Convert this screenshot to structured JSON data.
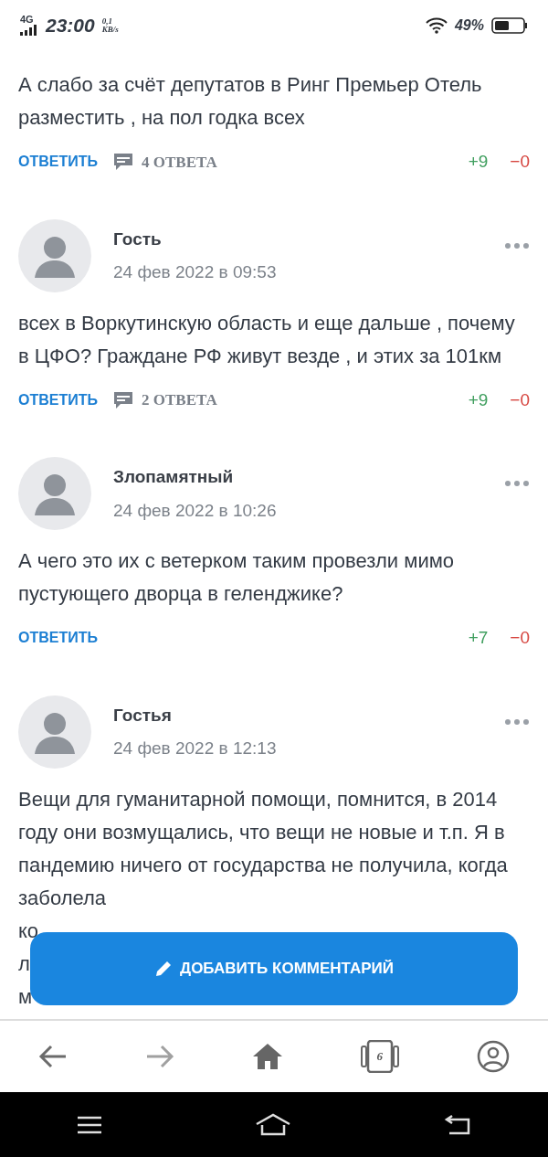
{
  "status_bar": {
    "network": "4G",
    "time": "23:00",
    "speed": "0,1",
    "speed_unit": "KB/s",
    "battery": "49%"
  },
  "comments": [
    {
      "text": "А слабо за счёт депутатов в Ринг Премьер Отель разместить , на пол годка всех",
      "reply": "ОТВЕТИТЬ",
      "replies": "4 ОТВЕТА",
      "plus": "+9",
      "minus": "−0"
    },
    {
      "author": "Гость",
      "date": "24 фев 2022 в 09:53",
      "text": "всех в Воркутинскую область и еще дальше , почему в ЦФО? Граждане РФ живут везде , и этих за 101км",
      "reply": "ОТВЕТИТЬ",
      "replies": "2 ОТВЕТА",
      "plus": "+9",
      "minus": "−0"
    },
    {
      "author": "Злопамятный",
      "date": "24 фев 2022 в 10:26",
      "text": "А чего это их с ветерком таким провезли мимо пустующего дворца в геленджике?",
      "reply": "ОТВЕТИТЬ",
      "plus": "+7",
      "minus": "−0"
    },
    {
      "author": "Гостья",
      "date": "24 фев 2022 в 12:13",
      "text": "Вещи для гуманитарной помощи, помнится, в 2014 году они возмущались, что вещи не новые и т.п. Я в пандемию ничего от государства не получила, когда заболела",
      "cut_lines": [
        "ко",
        "л",
        "м"
      ]
    }
  ],
  "fab": {
    "label": "ДОБАВИТЬ КОММЕНТАРИЙ"
  },
  "bottom_nav": {
    "tabs_count": "6"
  }
}
